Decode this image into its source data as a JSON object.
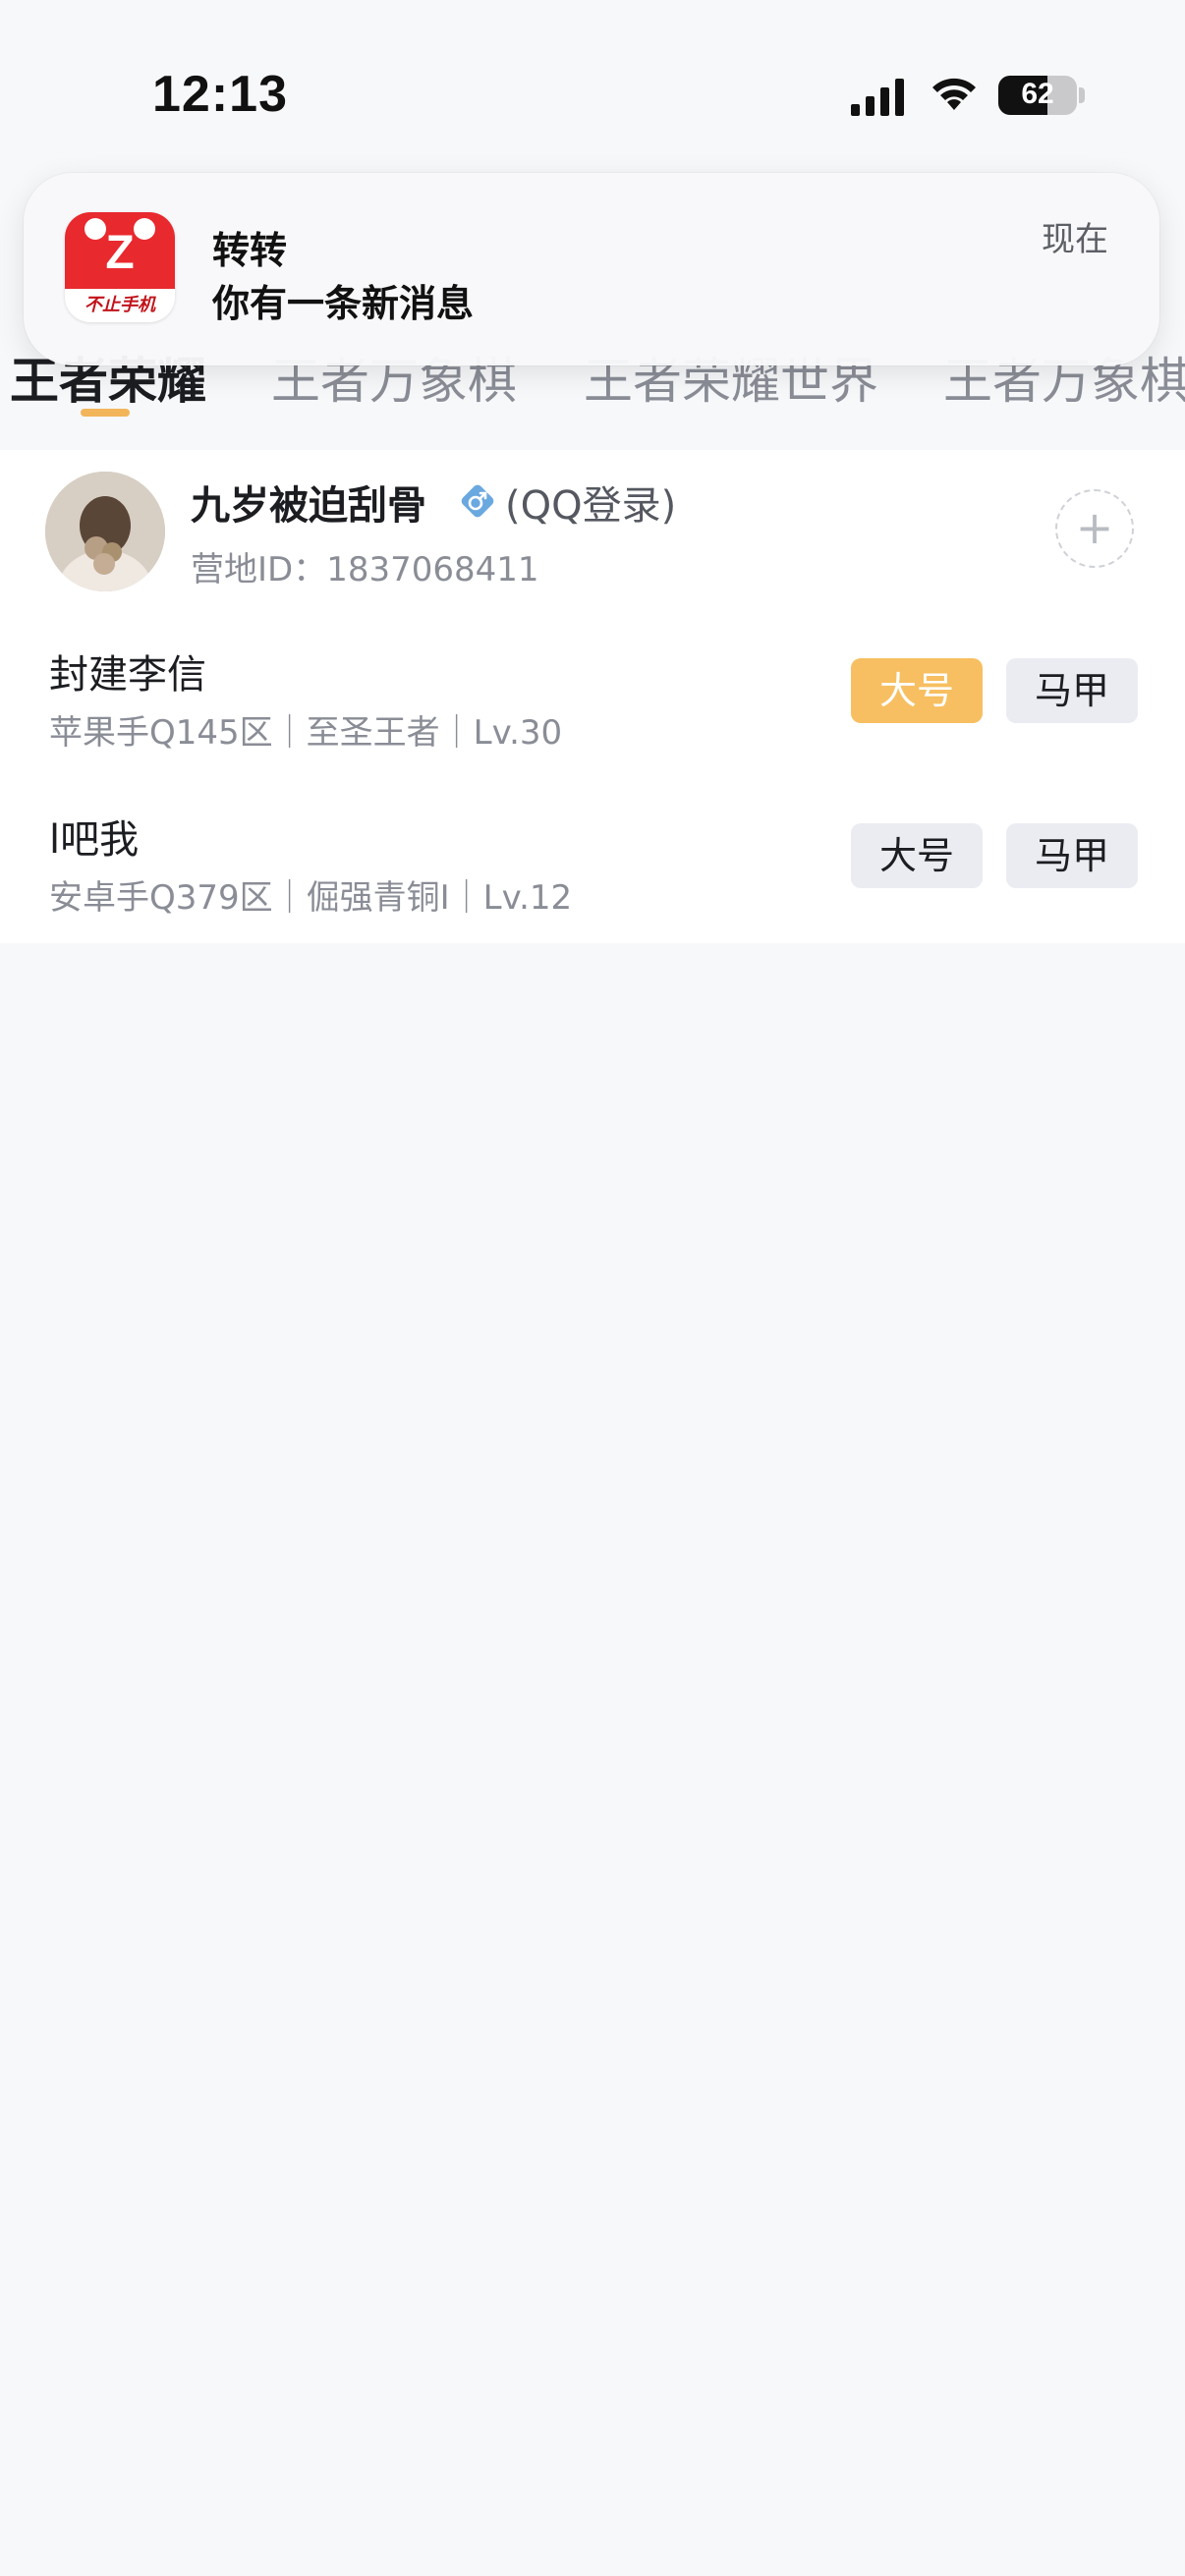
{
  "status_bar": {
    "time": "12:13",
    "battery_percent": "62",
    "battery_level": 0.62,
    "icons": [
      "signal-icon",
      "wifi-icon",
      "battery-icon"
    ]
  },
  "notification": {
    "app_name": "转转",
    "message": "你有一条新消息",
    "time": "现在",
    "icon_label": "不止手机",
    "icon_glyph": "Z",
    "brand_color": "#e8292e"
  },
  "tabs": [
    {
      "label": "王者荣耀",
      "active": true
    },
    {
      "label": "王者万象棋",
      "active": false
    },
    {
      "label": "王者荣耀世界",
      "active": false
    },
    {
      "label": "王者万象棋",
      "active": false
    }
  ],
  "colors": {
    "accent": "#f2b55a",
    "selected_tag": "#f7bf61",
    "tag_bg": "#eaecf2",
    "gender_icon": "#6aa8e0"
  },
  "account": {
    "name": "九岁被迫刮骨",
    "gender_icon": "male-icon",
    "login_type": "(QQ登录)",
    "camp_id": "营地ID：1837068411",
    "add_icon": "plus-icon"
  },
  "roles": [
    {
      "name": "封建李信",
      "detail": "苹果手Q145区｜至圣王者｜Lv.30",
      "main_label": "大号",
      "alt_label": "马甲",
      "selected": "main"
    },
    {
      "name": "l吧我",
      "detail": "安卓手Q379区｜倔强青铜I｜Lv.12",
      "main_label": "大号",
      "alt_label": "马甲",
      "selected": "none"
    }
  ]
}
